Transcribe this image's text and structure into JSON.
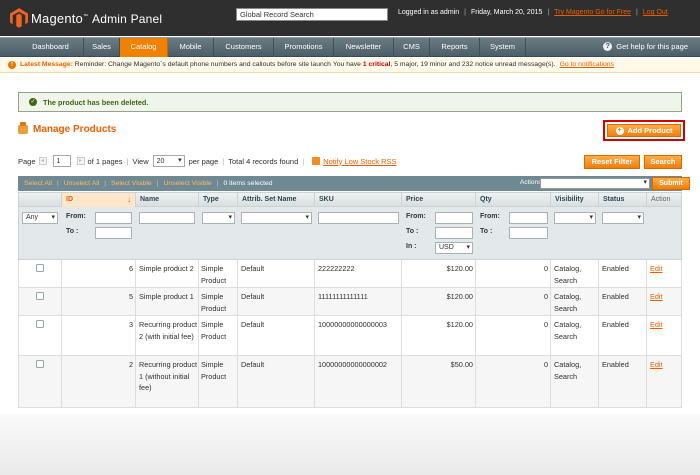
{
  "header": {
    "logo_brand": "Magento",
    "logo_sub": "Admin Panel",
    "search_value": "Global Record Search",
    "logged_in": "Logged in as admin",
    "date": "Friday, March 20, 2015",
    "try_link": "Try Magento Go for Free",
    "logout": "Log Out"
  },
  "nav": {
    "items": [
      "Dashboard",
      "Sales",
      "Catalog",
      "Mobile",
      "Customers",
      "Promotions",
      "Newsletter",
      "CMS",
      "Reports",
      "System"
    ],
    "active": "Catalog",
    "help": "Get help for this page"
  },
  "message": {
    "label": "Latest Message:",
    "text": "Reminder: Change Magento`s default phone numbers and callouts before site launch",
    "you_have": "You have",
    "critical_count": "1 critical",
    "rest": ", 5 major, 19 minor and 232 notice unread message(s).",
    "link": "Go to notifications"
  },
  "success": "The product has been deleted.",
  "page_title": "Manage Products",
  "add_product": "Add Product",
  "pager": {
    "page_label": "Page",
    "page_value": "1",
    "of_pages": "of 1 pages",
    "view_label": "View",
    "view_value": "20",
    "per_page": "per page",
    "total": "Total 4 records found",
    "rss": "Notify Low Stock RSS",
    "reset": "Reset Filter",
    "search": "Search"
  },
  "mass": {
    "select_all": "Select All",
    "unselect_all": "Unselect All",
    "select_visible": "Select Visible",
    "unselect_visible": "Unselect Visible",
    "count": "0 items selected",
    "actions_label": "Actions",
    "submit": "Submit"
  },
  "columns": [
    "ID",
    "Name",
    "Type",
    "Attrib. Set Name",
    "SKU",
    "Price",
    "Qty",
    "Visibility",
    "Status",
    "Action"
  ],
  "filters": {
    "any": "Any",
    "from": "From:",
    "to": "To :",
    "in": "In :",
    "currency": "USD"
  },
  "rows": [
    {
      "id": "6",
      "name": "Simple product 2",
      "type": "Simple Product",
      "attr": "Default",
      "sku": "222222222",
      "price": "$120.00",
      "qty": "0",
      "visibility": "Catalog, Search",
      "status": "Enabled",
      "action": "Edit"
    },
    {
      "id": "5",
      "name": "Simple product 1",
      "type": "Simple Product",
      "attr": "Default",
      "sku": "11111111111111",
      "price": "$120.00",
      "qty": "0",
      "visibility": "Catalog, Search",
      "status": "Enabled",
      "action": "Edit"
    },
    {
      "id": "3",
      "name": "Recurring product 2 (with initial fee)",
      "type": "Simple Product",
      "attr": "Default",
      "sku": "10000000000000003",
      "price": "$120.00",
      "qty": "0",
      "visibility": "Catalog, Search",
      "status": "Enabled",
      "action": "Edit"
    },
    {
      "id": "2",
      "name": "Recurring product 1 (without initial fee)",
      "type": "Simple Product",
      "attr": "Default",
      "sku": "10000000000000002",
      "price": "$50.00",
      "qty": "0",
      "visibility": "Catalog, Search",
      "status": "Enabled",
      "action": "Edit"
    }
  ],
  "colors": {
    "accent": "#eb5e00",
    "header": "#2f2f2f",
    "nav": "#5a6d76"
  }
}
